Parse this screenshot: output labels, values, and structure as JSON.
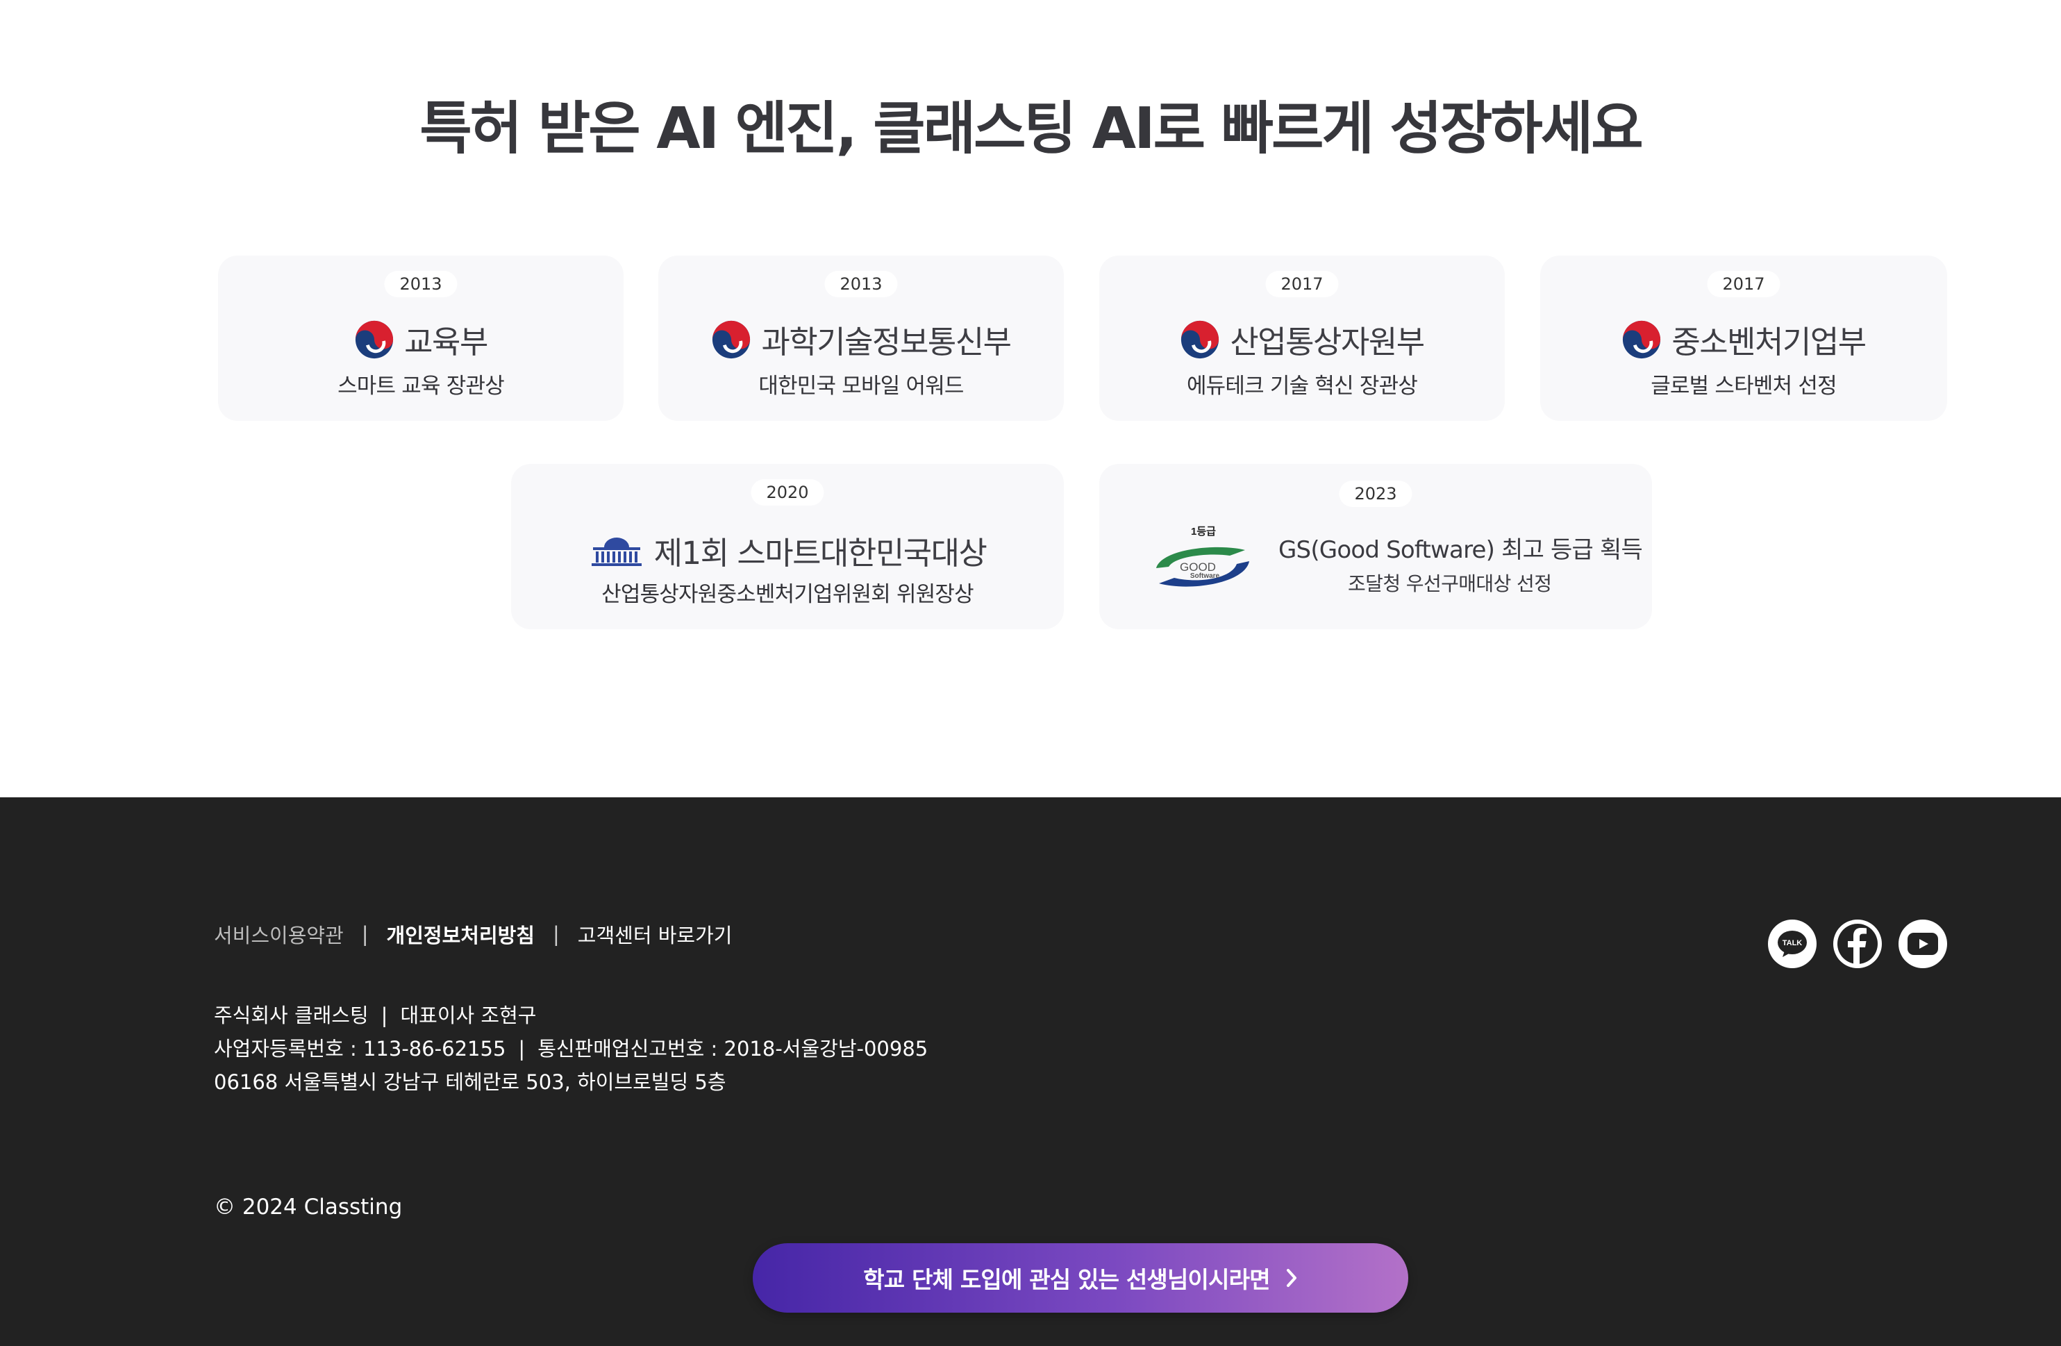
{
  "headline": "특허 받은 AI 엔진, 클래스팅 AI로 빠르게 성장하세요",
  "awards_row1": [
    {
      "year": "2013",
      "org": "교육부",
      "award": "스마트 교육 장관상",
      "icon": "korea-government-emblem-icon"
    },
    {
      "year": "2013",
      "org": "과학기술정보통신부",
      "award": "대한민국 모바일 어워드",
      "icon": "korea-government-emblem-icon"
    },
    {
      "year": "2017",
      "org": "산업통상자원부",
      "award": "에듀테크 기술 혁신 장관상",
      "icon": "korea-government-emblem-icon"
    },
    {
      "year": "2017",
      "org": "중소벤처기업부",
      "award": "글로벌 스타벤처 선정",
      "icon": "korea-government-emblem-icon"
    }
  ],
  "award_assembly": {
    "year": "2020",
    "title": "제1회 스마트대한민국대상",
    "award": "산업통상자원중소벤처기업위원회 위원장상",
    "icon": "national-assembly-icon"
  },
  "award_gs": {
    "year": "2023",
    "logo_grade": "1등급",
    "logo_text_1": "GOOD",
    "logo_text_2": "Software",
    "title": "GS(Good Software) 최고 등급 획득",
    "award": "조달청 우선구매대상 선정"
  },
  "footer": {
    "links": {
      "terms": "서비스이용약관",
      "privacy": "개인정보처리방침",
      "help": "고객센터 바로가기",
      "separator": "|"
    },
    "company": "주식회사 클래스팅",
    "ceo": "대표이사 조현구",
    "business_no": "사업자등록번호 : 113-86-62155",
    "ecommerce_no": "통신판매업신고번호 : 2018-서울강남-00985",
    "address": "06168 서울특별시 강남구 테헤란로 503, 하이브로빌딩 5층",
    "copyright": "© 2024 Classting",
    "social": {
      "kakao_label": "TALK",
      "icons": [
        "kakaotalk-icon",
        "facebook-icon",
        "youtube-icon"
      ]
    }
  },
  "cta": {
    "label": "학교 단체 도입에 관심 있는 선생님이시라면",
    "icon": "chevron-right-icon"
  },
  "colors": {
    "footer_bg": "#222222",
    "card_bg": "#f8f8fa",
    "cta_start": "#4626a7",
    "cta_end": "#b371c8"
  }
}
